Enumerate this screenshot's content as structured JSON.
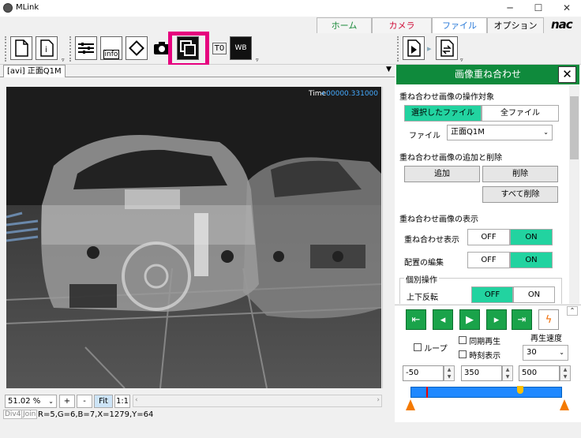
{
  "window": {
    "title": "MLink",
    "minimize": "─",
    "maximize": "☐",
    "close": "✕"
  },
  "menu": {
    "tabs": [
      "ホーム",
      "カメラ",
      "ファイル",
      "オプション"
    ],
    "active": "ファイル",
    "logo": "nac"
  },
  "toolbar": {
    "t0_label": "T0",
    "wb_label": "WB",
    "info_label": "info",
    "i_label": "i"
  },
  "document": {
    "tab": "[avi] 正面Q1M",
    "time_label": "Time",
    "time_value": "+00000.331000"
  },
  "zoom": {
    "value": "51.02 %",
    "plus": "+",
    "minus": "-",
    "fit": "Fit",
    "one": "1:1"
  },
  "status": {
    "div4": "Div4",
    "join": "Join",
    "pixel": "R=5,G=6,B=7,X=1279,Y=64"
  },
  "panel": {
    "title": "画像重ね合わせ",
    "section1": "重ね合わせ画像の操作対象",
    "target_selected": "選択したファイル",
    "target_all": "全ファイル",
    "file_label": "ファイル",
    "file_value": "正面Q1M",
    "section2": "重ね合わせ画像の追加と削除",
    "add": "追加",
    "delete": "削除",
    "delete_all": "すべて削除",
    "section3": "重ね合わせ画像の表示",
    "overlay_label": "重ね合わせ表示",
    "layout_label": "配置の編集",
    "off": "OFF",
    "on": "ON",
    "group": "個別操作",
    "flip_label": "上下反転"
  },
  "playback": {
    "loop": "ループ",
    "sync": "同期再生",
    "time_display": "時刻表示",
    "speed_label": "再生速度",
    "speed_value": "30",
    "start": "-50",
    "current": "350",
    "end": "500"
  },
  "colors": {
    "accent": "#0f8a3c",
    "on": "#22d3a0",
    "highlight": "#e6007e",
    "play": "#1aa34a"
  }
}
